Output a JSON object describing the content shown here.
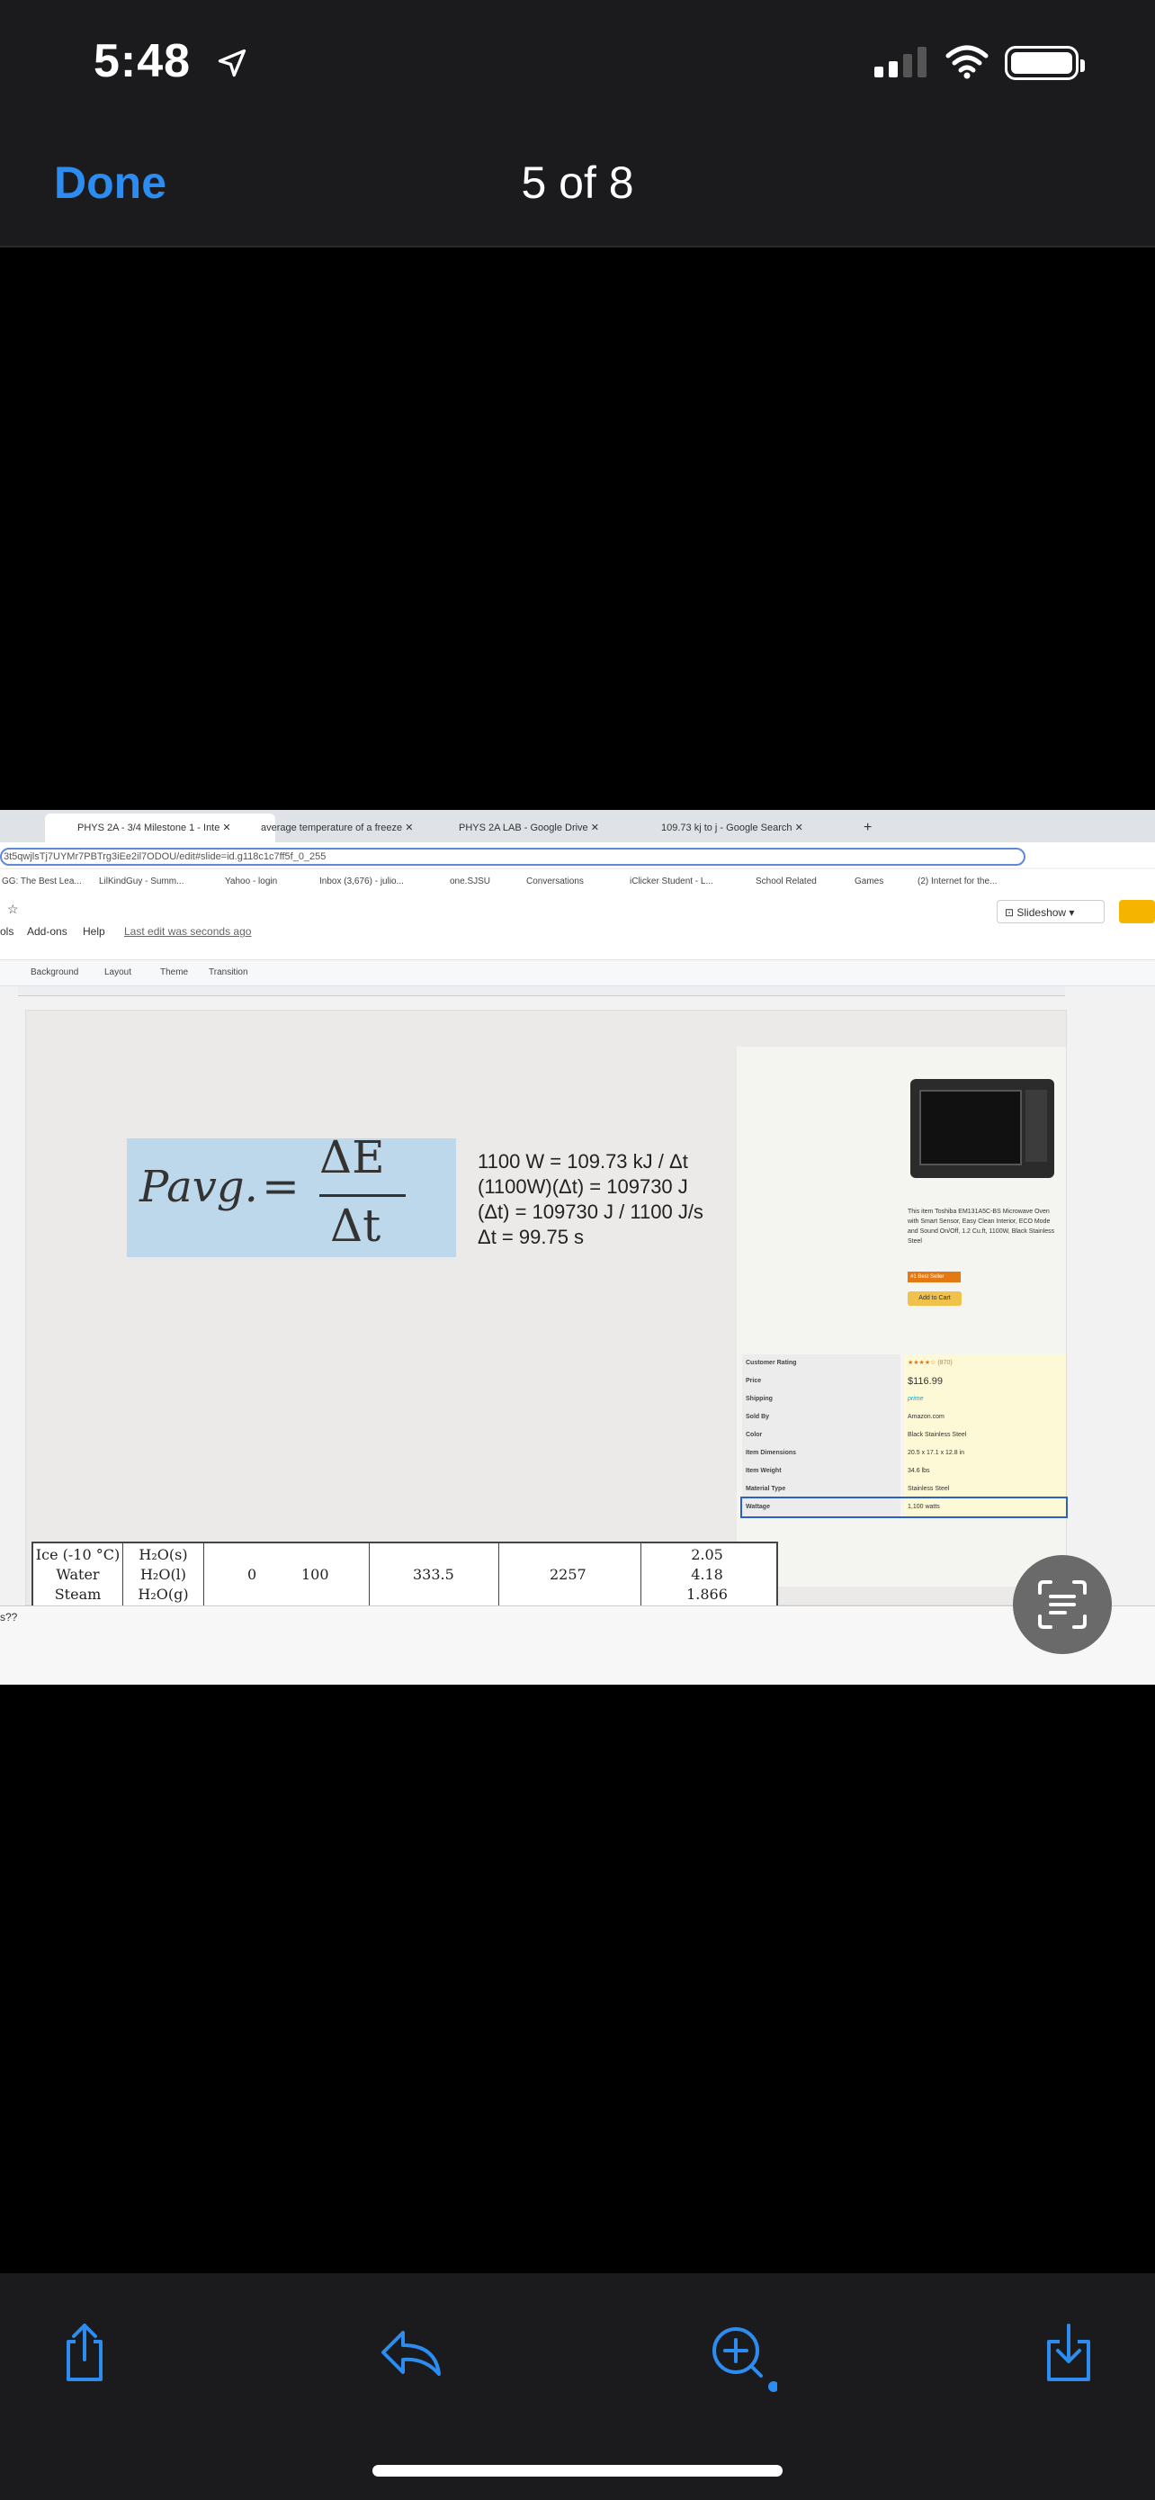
{
  "status": {
    "time": "5:48"
  },
  "header": {
    "done_label": "Done",
    "counter": "5 of 8"
  },
  "browser": {
    "tabs": [
      "PHYS 2A - 3/4 Milestone 1 - Inte",
      "average temperature of a freeze",
      "PHYS 2A LAB - Google Drive",
      "109.73 kj to j - Google Search"
    ],
    "url": "3t5qwjlsTj7UYMr7PBTrg3iEe2il7ODOU/edit#slide=id.g118c1c7ff5f_0_255",
    "bookmarks": [
      "GG: The Best Lea...",
      "LilKindGuy - Summ...",
      "Yahoo - login",
      "Inbox (3,676) - julio...",
      "one.SJSU",
      "Conversations",
      "iClicker Student - L...",
      "School Related",
      "Games",
      "(2) Internet for the..."
    ]
  },
  "slides_app": {
    "menu": [
      "ols",
      "Add-ons",
      "Help"
    ],
    "last_edit": "Last edit was seconds ago",
    "slideshow_label": "Slideshow",
    "toolbar": [
      "Background",
      "Layout",
      "Theme",
      "Transition"
    ]
  },
  "slide": {
    "formula_lhs": "Pavg.",
    "formula_eq": "=",
    "formula_num": "ΔE",
    "formula_den": "Δt",
    "calc_lines": [
      "1100 W = 109.73 kJ / Δt",
      "(1100W)(Δt) =  109730 J",
      "(Δt) = 109730 J / 1100 J/s",
      "Δt = 99.75 s"
    ],
    "product": {
      "description": "This item Toshiba EM131A5C-BS Microwave Oven with Smart Sensor, Easy Clean Interior, ECO Mode and Sound On/Off, 1.2 Cu.ft, 1100W, Black Stainless Steel",
      "badge": "#1 Best Seller",
      "cart_label": "Add to Cart",
      "specs": [
        {
          "k": "Customer Rating",
          "v": "★★★★☆ (870)"
        },
        {
          "k": "Price",
          "v": "$116.99"
        },
        {
          "k": "Shipping",
          "v": "prime"
        },
        {
          "k": "Sold By",
          "v": "Amazon.com"
        },
        {
          "k": "Color",
          "v": "Black Stainless Steel"
        },
        {
          "k": "Item Dimensions",
          "v": "20.5 x 17.1 x 12.8 in"
        },
        {
          "k": "Item Weight",
          "v": "34.6 lbs"
        },
        {
          "k": "Material Type",
          "v": "Stainless Steel"
        },
        {
          "k": "Wattage",
          "v": "1,100 watts"
        }
      ]
    },
    "table": {
      "states": [
        "Ice (-10 °C)",
        "Water",
        "Steam"
      ],
      "formulas": [
        "H₂O(s)",
        "H₂O(l)",
        "H₂O(g)"
      ],
      "v1": "0",
      "v2": "100",
      "v3": "333.5",
      "v4": "2257",
      "specific_heats": [
        "2.05",
        "4.18",
        "1.866"
      ]
    },
    "bottom_text": "s??"
  }
}
